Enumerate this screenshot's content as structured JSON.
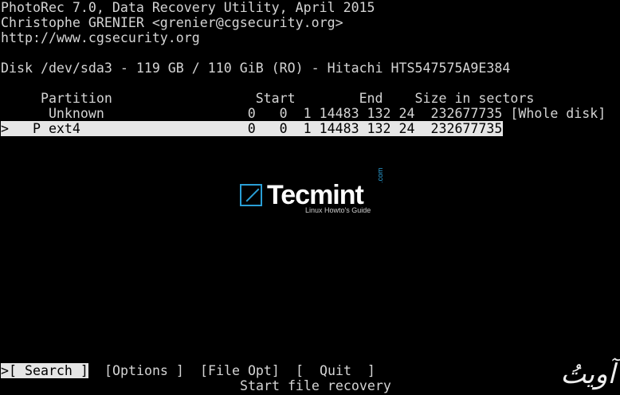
{
  "header": {
    "title_line": "PhotoRec 7.0, Data Recovery Utility, April 2015",
    "author_line": "Christophe GRENIER <grenier@cgsecurity.org>",
    "url_line": "http://www.cgsecurity.org"
  },
  "disk": {
    "info_line": "Disk /dev/sda3 - 119 GB / 110 GiB (RO) - Hitachi HTS547575A9E384"
  },
  "partition_table": {
    "header_line": "     Partition                  Start        End    Size in sectors",
    "rows": [
      {
        "line": "      Unknown                  0   0  1 14483 132 24  232677735 [Whole disk]"
      },
      {
        "line": ">   P ext4                     0   0  1 14483 132 24  232677735"
      }
    ]
  },
  "menu": {
    "search": ">[ Search ]",
    "options": "[Options ]",
    "file_opt": "[File Opt]",
    "quit": "[  Quit  ]"
  },
  "status": {
    "hint": "Start file recovery"
  },
  "watermark": {
    "brand": "Tecmint",
    "domain": ".com",
    "tagline": "Linux Howto's Guide"
  },
  "corner_logo": {
    "text": "آویتُ"
  }
}
